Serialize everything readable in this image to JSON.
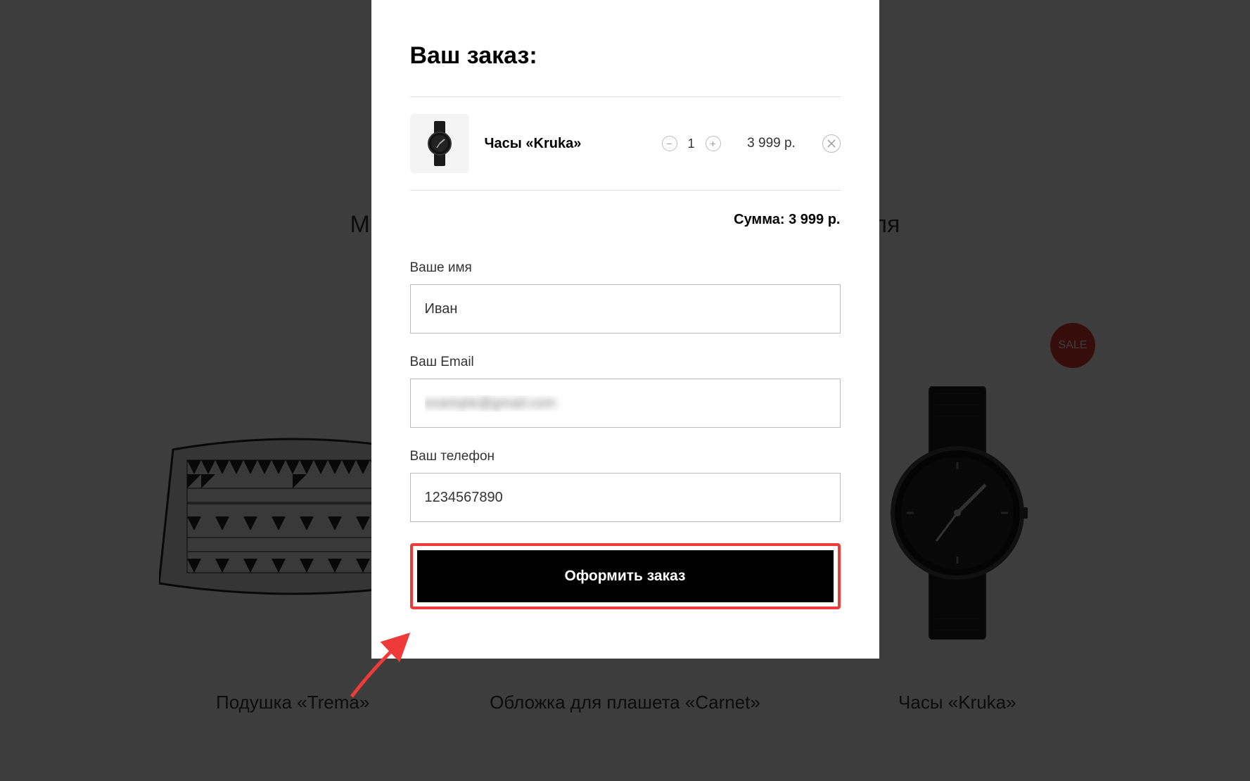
{
  "background": {
    "tagline": "Мы любим делать красивые и удобные вещи для",
    "products": [
      {
        "name": "Подушка «Trema»"
      },
      {
        "name": "Обложка для плашета «Carnet»"
      },
      {
        "name": "Часы «Kruka»",
        "badge": "SALE"
      }
    ]
  },
  "modal": {
    "title": "Ваш заказ:",
    "order_item": {
      "name": "Часы «Kruka»",
      "quantity": "1",
      "price": "3 999 р."
    },
    "total_label": "Сумма:",
    "total_value": "3 999 р.",
    "form": {
      "name_label": "Ваше имя",
      "name_value": "Иван",
      "email_label": "Ваш Email",
      "email_value": "example@gmail.com",
      "phone_label": "Ваш телефон",
      "phone_value": "1234567890"
    },
    "submit_label": "Оформить заказ"
  },
  "annotation": {
    "highlight_color": "#ef3a3a"
  }
}
